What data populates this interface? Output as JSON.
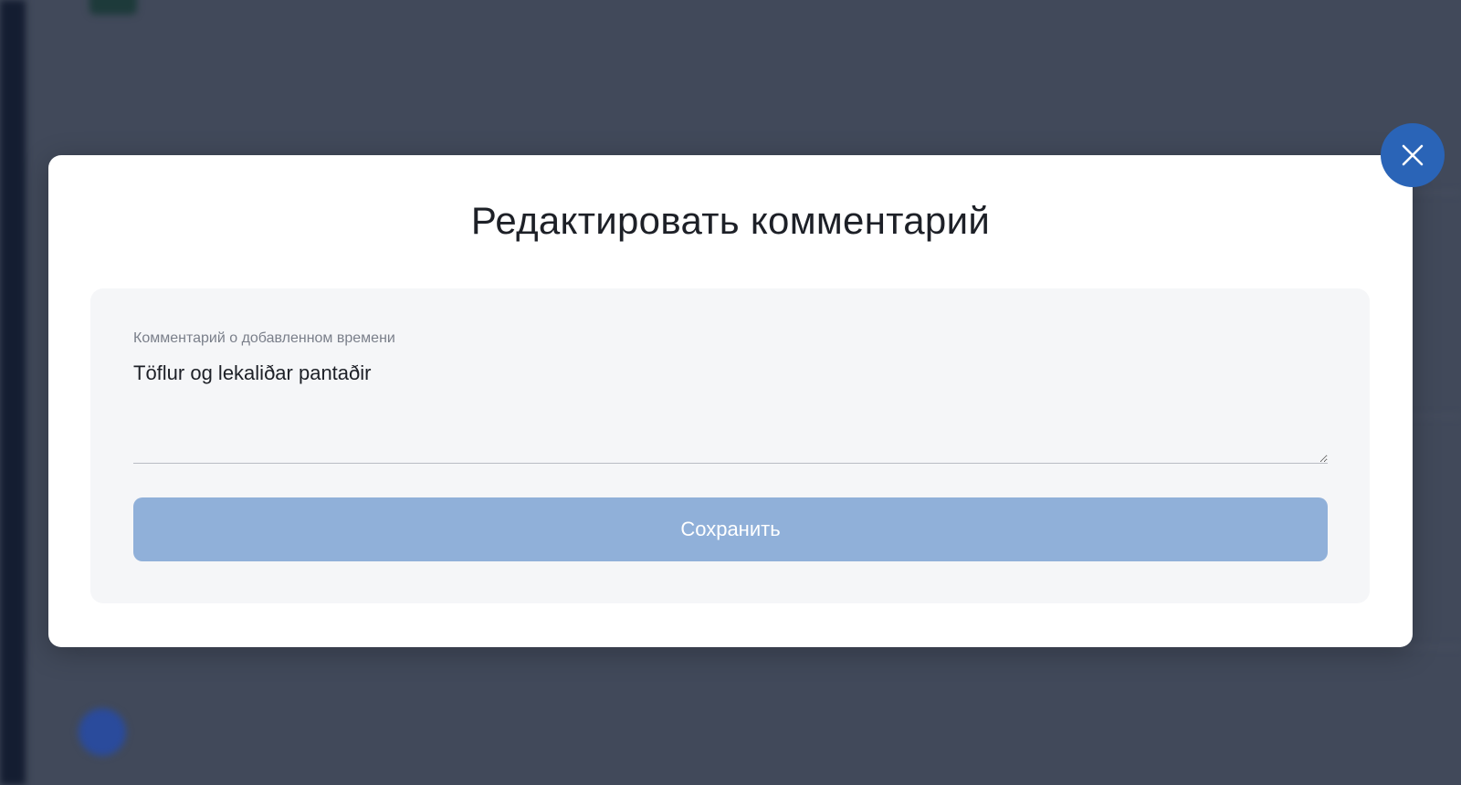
{
  "modal": {
    "title": "Редактировать комментарий",
    "field_label": "Комментарий о добавленном времени",
    "comment_value": "Töflur og lekaliðar pantaðir",
    "save_label": "Сохранить",
    "close_icon": "close-icon"
  },
  "colors": {
    "accent": "#2a64b7",
    "button_disabled": "#90b0d9",
    "overlay": "#41495a"
  }
}
